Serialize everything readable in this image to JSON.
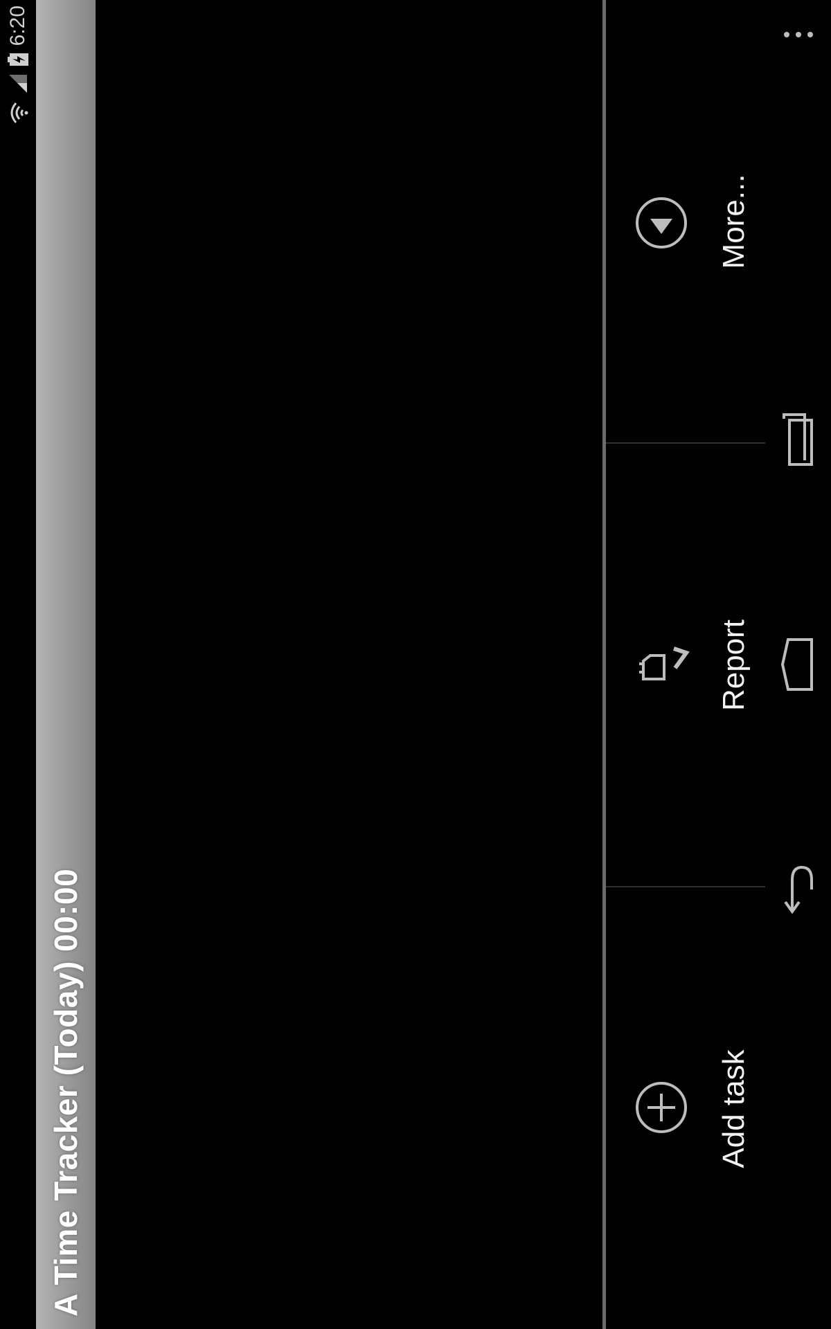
{
  "status_bar": {
    "time": "6:20",
    "icons": [
      "wifi-icon",
      "signal-icon",
      "battery-charging-icon"
    ]
  },
  "app": {
    "title": "A Time Tracker (Today) 00:00"
  },
  "menu": {
    "items": [
      {
        "label": "More...",
        "icon": "play-circle-icon"
      },
      {
        "label": "Report",
        "icon": "report-icon"
      },
      {
        "label": "Add task",
        "icon": "add-circle-icon"
      }
    ]
  },
  "nav_bar": {
    "buttons": [
      "overflow-menu-icon",
      "recent-apps-icon",
      "home-icon",
      "back-icon"
    ]
  },
  "colors": {
    "background": "#000000",
    "title_gradient_start": "#b4b4b4",
    "title_gradient_end": "#858585",
    "divider": "#6a6a6a",
    "menu_text": "#f2f2f2",
    "icon_stroke": "#bdbdbd"
  }
}
